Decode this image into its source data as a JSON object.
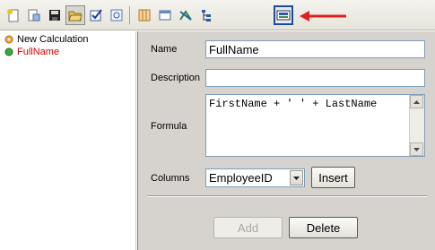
{
  "toolbar": {
    "buttons": [
      {
        "icon": "new-document-icon"
      },
      {
        "icon": "properties-icon"
      },
      {
        "icon": "save-icon"
      },
      {
        "icon": "open-folder-icon"
      },
      {
        "icon": "check-icon"
      },
      {
        "icon": "preview-icon"
      },
      {
        "icon": "grid-columns-icon"
      },
      {
        "icon": "window-icon"
      },
      {
        "icon": "relations-icon"
      },
      {
        "icon": "tree-icon"
      },
      {
        "icon": "calculator-icon"
      }
    ],
    "pointer_color": "#e02020"
  },
  "tree": {
    "items": [
      {
        "label": "New Calculation",
        "icon": "calculation-folder-icon"
      },
      {
        "label": "FullName",
        "icon": "calculated-field-icon",
        "selected": true
      }
    ]
  },
  "form": {
    "name_label": "Name",
    "name_value": "FullName",
    "description_label": "Description",
    "description_value": "",
    "formula_label": "Formula",
    "formula_value": "FirstName + ' ' + LastName",
    "columns_label": "Columns",
    "columns_selected": "EmployeeID",
    "insert_label": "Insert",
    "add_label": "Add",
    "delete_label": "Delete"
  },
  "colors": {
    "selected_text": "#d40000",
    "panel_bg": "#d6d3ce"
  }
}
